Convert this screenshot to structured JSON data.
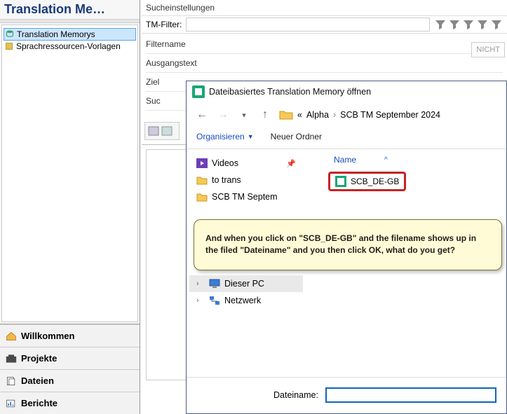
{
  "left": {
    "title": "Translation Me…",
    "tree": [
      {
        "label": "Translation Memorys",
        "selected": true
      },
      {
        "label": "Sprachressourcen-Vorlagen",
        "selected": false
      }
    ],
    "views": [
      {
        "label": "Willkommen",
        "icon": "home"
      },
      {
        "label": "Projekte",
        "icon": "projects"
      },
      {
        "label": "Dateien",
        "icon": "files"
      },
      {
        "label": "Berichte",
        "icon": "reports"
      }
    ]
  },
  "search": {
    "header": "Sucheinstellungen",
    "tm_filter_label": "TM-Filter:",
    "fields": {
      "filtername": "Filtername",
      "ausgangstext": "Ausgangstext",
      "ziel": "Ziel",
      "suc": "Suc"
    },
    "nicht": "NICHT"
  },
  "dialog": {
    "title": "Dateibasiertes Translation Memory öffnen",
    "crumb_prefix": "«",
    "crumbs": [
      "Alpha",
      "SCB TM September 2024"
    ],
    "organize": "Organisieren",
    "new_folder": "Neuer Ordner",
    "left_items": [
      {
        "label": "Videos",
        "icon": "video",
        "pin": true
      },
      {
        "label": "to trans",
        "icon": "folder"
      },
      {
        "label": "SCB TM Septem",
        "icon": "folder"
      }
    ],
    "left_bottom": [
      {
        "label": "Dieser PC",
        "icon": "pc",
        "expand": true,
        "active": true
      },
      {
        "label": "Netzwerk",
        "icon": "net",
        "expand": true
      }
    ],
    "col_name": "Name",
    "file": "SCB_DE-GB",
    "tooltip": "And when you click on \"SCB_DE-GB\" and the filename shows up in the filed \"Dateiname\" and you then click OK, what do you get?",
    "footer_label": "Dateiname:",
    "footer_value": ""
  }
}
